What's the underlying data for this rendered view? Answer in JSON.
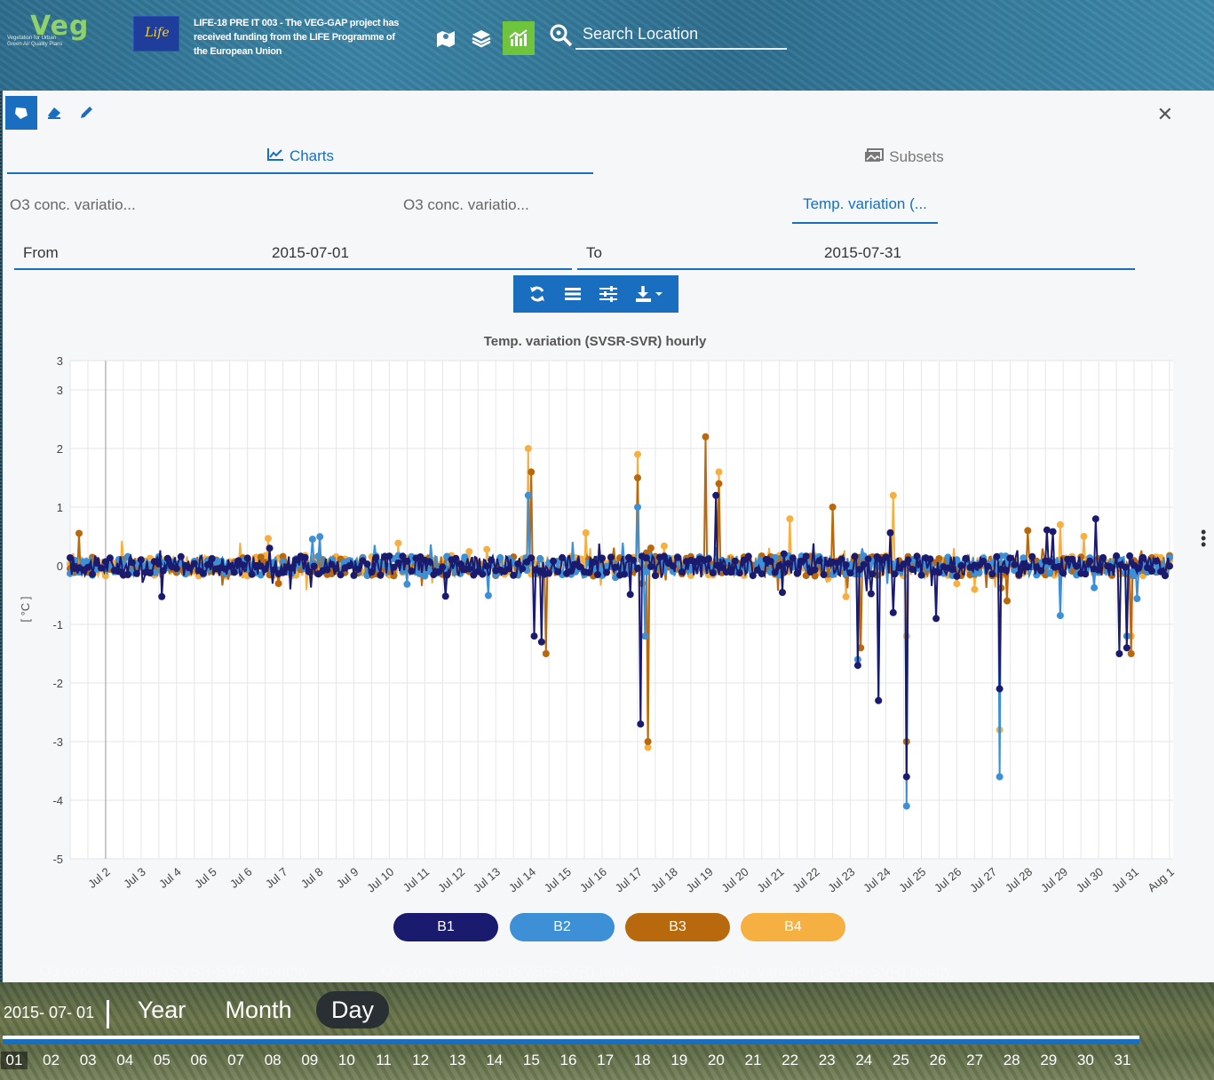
{
  "header": {
    "logo_main": "Veg",
    "logo_sub": "Vegetation for Urban Green Air Quality Plans",
    "eu_flag_text": "Life",
    "funding_text": "LIFE-18 PRE IT 003 - The VEG-GAP project has received funding from the LIFE Programme of the European Union",
    "search_placeholder": "Search Location"
  },
  "tabs": {
    "charts": "Charts",
    "subsets": "Subsets"
  },
  "subtabs": [
    "O3 conc. variatio...",
    "O3 conc. variatio...",
    "Temp. variation (..."
  ],
  "date_range": {
    "from_label": "From",
    "from_value": "2015-07-01",
    "to_label": "To",
    "to_value": "2015-07-31"
  },
  "chart_data": {
    "type": "line",
    "title": "Temp. variation (SVSR-SVR) hourly",
    "ylabel": "[ °C ]",
    "ylim": [
      -5,
      3.5
    ],
    "yticks": [
      3,
      3,
      2,
      1,
      0,
      -1,
      -2,
      -3,
      -4,
      -5
    ],
    "xticks": [
      "Jul 2",
      "Jul 3",
      "Jul 4",
      "Jul 5",
      "Jul 6",
      "Jul 7",
      "Jul 8",
      "Jul 9",
      "Jul 10",
      "Jul 11",
      "Jul 12",
      "Jul 13",
      "Jul 14",
      "Jul 15",
      "Jul 16",
      "Jul 17",
      "Jul 18",
      "Jul 19",
      "Jul 20",
      "Jul 21",
      "Jul 22",
      "Jul 23",
      "Jul 24",
      "Jul 25",
      "Jul 26",
      "Jul 27",
      "Jul 28",
      "Jul 29",
      "Jul 30",
      "Jul 31",
      "Aug 1"
    ],
    "series": [
      {
        "name": "B1",
        "color": "#1a1a6e"
      },
      {
        "name": "B2",
        "color": "#3d8fd6"
      },
      {
        "name": "B3",
        "color": "#b8690e"
      },
      {
        "name": "B4",
        "color": "#f6b042"
      }
    ],
    "grid": true,
    "legend": "bottom"
  },
  "ghost_list": [
    "O3 conc. variation (SVSR-SVR) monthly",
    "O3 conc. variation (SVSR-SVR) hourly",
    "Temp. variation (SVSR-SVR) hourly"
  ],
  "timeline": {
    "current_date": "2015- 07- 01",
    "periods": [
      "Year",
      "Month",
      "Day"
    ],
    "active_period": "Day",
    "days": [
      "01",
      "02",
      "03",
      "04",
      "05",
      "06",
      "07",
      "08",
      "09",
      "10",
      "11",
      "12",
      "13",
      "14",
      "15",
      "16",
      "17",
      "18",
      "19",
      "20",
      "21",
      "22",
      "23",
      "24",
      "25",
      "26",
      "27",
      "28",
      "29",
      "30",
      "31"
    ]
  }
}
